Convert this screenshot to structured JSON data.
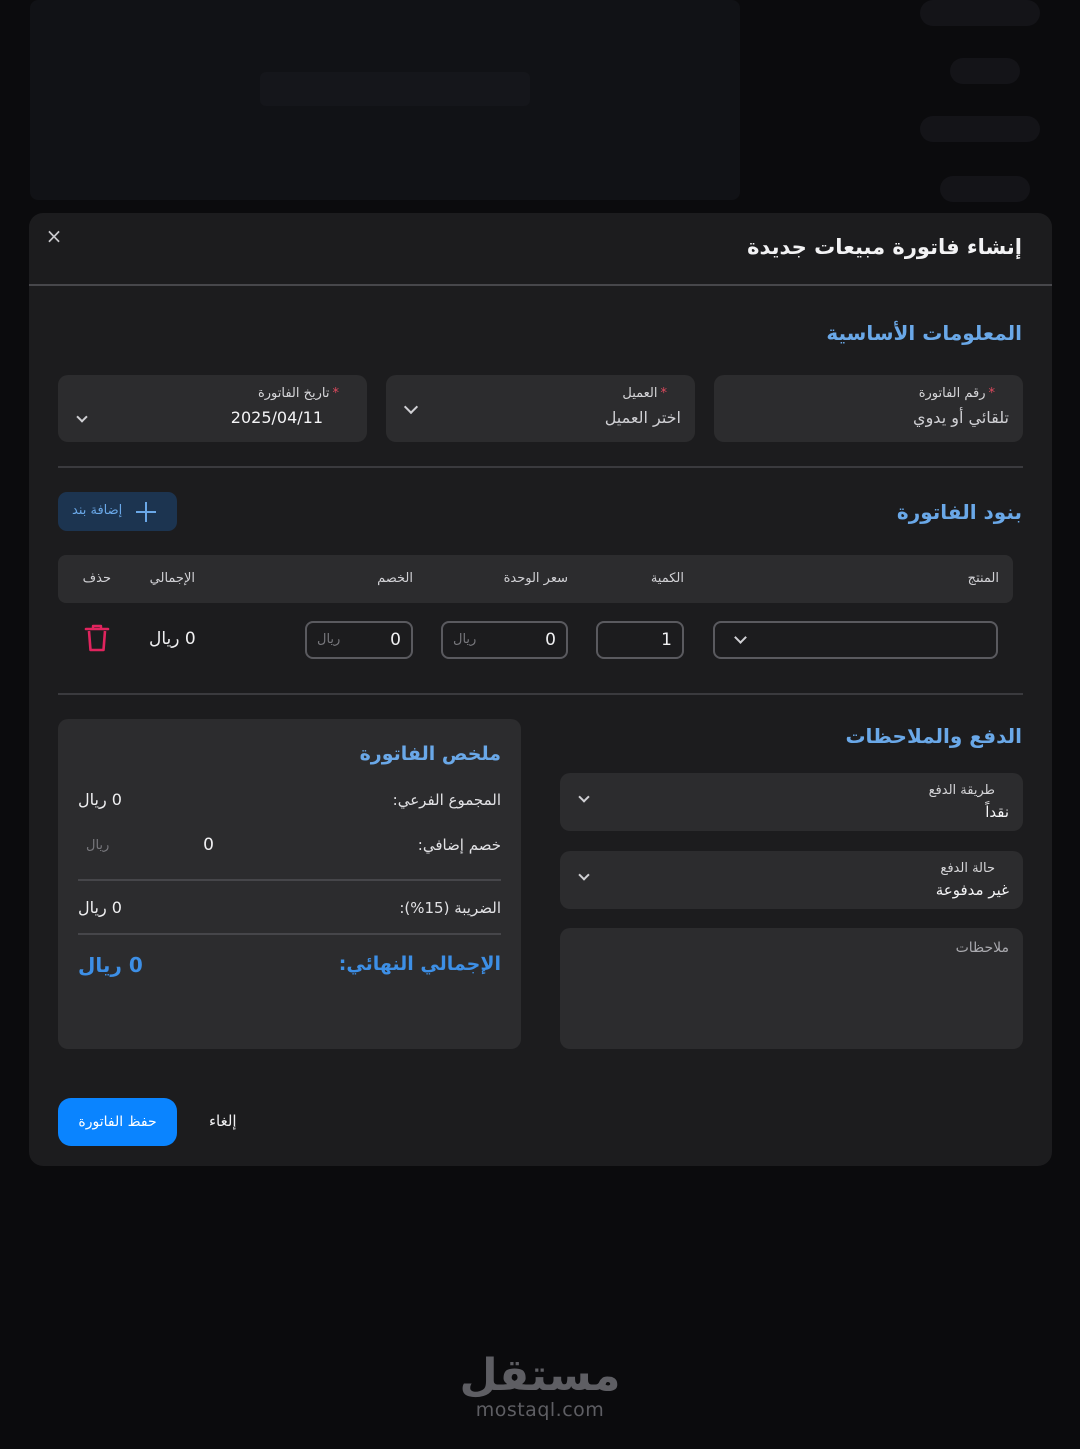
{
  "modal": {
    "title": "إنشاء فاتورة مبيعات جديدة",
    "close_icon": "×"
  },
  "basic_info": {
    "title": "المعلومات الأساسية",
    "invoice_number": {
      "label": "رقم الفاتورة",
      "placeholder": "تلقائي أو يدوي",
      "required_mark": "*"
    },
    "customer": {
      "label": "العميل",
      "placeholder": "اختر العميل",
      "required_mark": "*"
    },
    "invoice_date": {
      "label": "تاريخ الفاتورة",
      "value": "2025/04/11",
      "required_mark": "*"
    }
  },
  "items": {
    "title": "بنود الفاتورة",
    "add_label": "إضافة بند",
    "columns": {
      "product": "المنتج",
      "quantity": "الكمية",
      "unit_price": "سعر الوحدة",
      "discount": "الخصم",
      "total": "الإجمالي",
      "delete": "حذف"
    },
    "rows": [
      {
        "product": "",
        "quantity": "1",
        "unit_price": "0",
        "unit_price_unit": "ريال",
        "discount": "0",
        "discount_unit": "ريال",
        "total": "0 ريال"
      }
    ]
  },
  "payment": {
    "title": "الدفع والملاحظات",
    "method": {
      "label": "طريقة الدفع",
      "value": "نقداً"
    },
    "status": {
      "label": "حالة الدفع",
      "value": "غير مدفوعة"
    },
    "notes_placeholder": "ملاحظات"
  },
  "summary": {
    "title": "ملخص الفاتورة",
    "subtotal_label": "المجموع الفرعي:",
    "subtotal_value": "0 ريال",
    "extra_discount_label": "خصم إضافي:",
    "extra_discount_value": "0",
    "extra_discount_unit": "ريال",
    "tax_label": "الضريبة (15%):",
    "tax_value": "0 ريال",
    "final_label": "الإجمالي النهائي:",
    "final_value": "0 ريال"
  },
  "actions": {
    "save": "حفظ الفاتورة",
    "cancel": "إلغاء"
  },
  "watermark": {
    "arabic": "مستقل",
    "latin": "mostaql.com"
  },
  "colors": {
    "accent": "#6aa8e8",
    "primary_button": "#0a84ff",
    "danger": "#e0245e",
    "modal_bg": "#1c1c1e",
    "field_bg": "#2c2c2e"
  }
}
